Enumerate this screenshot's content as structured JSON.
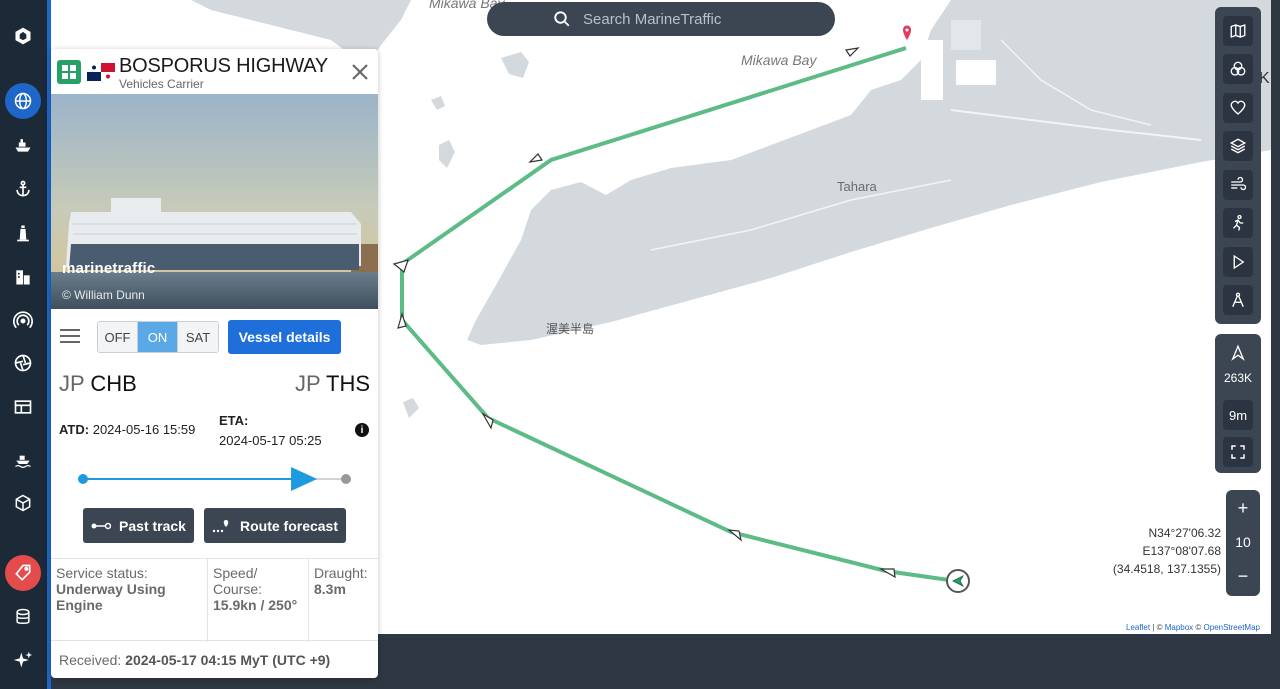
{
  "search": {
    "placeholder": "Search MarineTraffic"
  },
  "nav": {
    "items": [
      "logo-icon",
      "globe-icon",
      "ship-icon",
      "anchor-icon",
      "lighthouse-icon",
      "buildings-icon",
      "signal-icon",
      "aperture-icon",
      "table-icon",
      "ship-wave-icon",
      "cube-icon",
      "tag-icon",
      "database-icon",
      "sparkle-icon"
    ]
  },
  "map": {
    "labels": {
      "mikawa_bay_top": "Mikawa Bay",
      "mikawa_bay": "Mikawa Bay",
      "tahara": "Tahara",
      "atsumi": "渥美半島"
    },
    "coords": {
      "lat": "N34°27'06.32",
      "lon": "E137°08'07.68",
      "decimal": "(34.4518, 137.1355)"
    },
    "attribution": {
      "leaflet": "Leaflet",
      "sep1": " | © ",
      "mapbox": "Mapbox",
      "sep2": " © ",
      "osm": "OpenStreetMap"
    },
    "edge_letter": "K"
  },
  "tools": {
    "scale": "263K",
    "time": "9m",
    "zoom": "10",
    "zoom_in": "+",
    "zoom_out": "−"
  },
  "vessel": {
    "name": "BOSPORUS HIGHWAY",
    "type": "Vehicles Carrier",
    "photo_watermark": "marinetraffic",
    "photo_credit": "© William Dunn",
    "toggle": {
      "off": "OFF",
      "on": "ON",
      "sat": "SAT",
      "selected": "ON"
    },
    "details_button": "Vessel details",
    "departure": {
      "country": "JP",
      "port": "CHB"
    },
    "arrival": {
      "country": "JP",
      "port": "THS"
    },
    "atd_label": "ATD:",
    "atd_value": "2024-05-16 15:59",
    "eta_label": "ETA:",
    "eta_value": "2024-05-17 05:25",
    "info": "i",
    "voyage_progress": 0.89,
    "past_track": "Past track",
    "route_forecast": "Route forecast",
    "status_label": "Service status:",
    "status_value": "Underway Using Engine",
    "speed_label": "Speed/ Course:",
    "speed_value": "15.9kn / 250°",
    "draught_label": "Draught:",
    "draught_value": "8.3m",
    "received_label": "Received:",
    "received_value": "2024-05-17 04:15 MyT (UTC +9)"
  },
  "colors": {
    "accent": "#1e66c8",
    "route": "#5dbb86",
    "land": "#d4d9de",
    "vessel_type": "#26a269",
    "tag": "#e44c4c"
  }
}
